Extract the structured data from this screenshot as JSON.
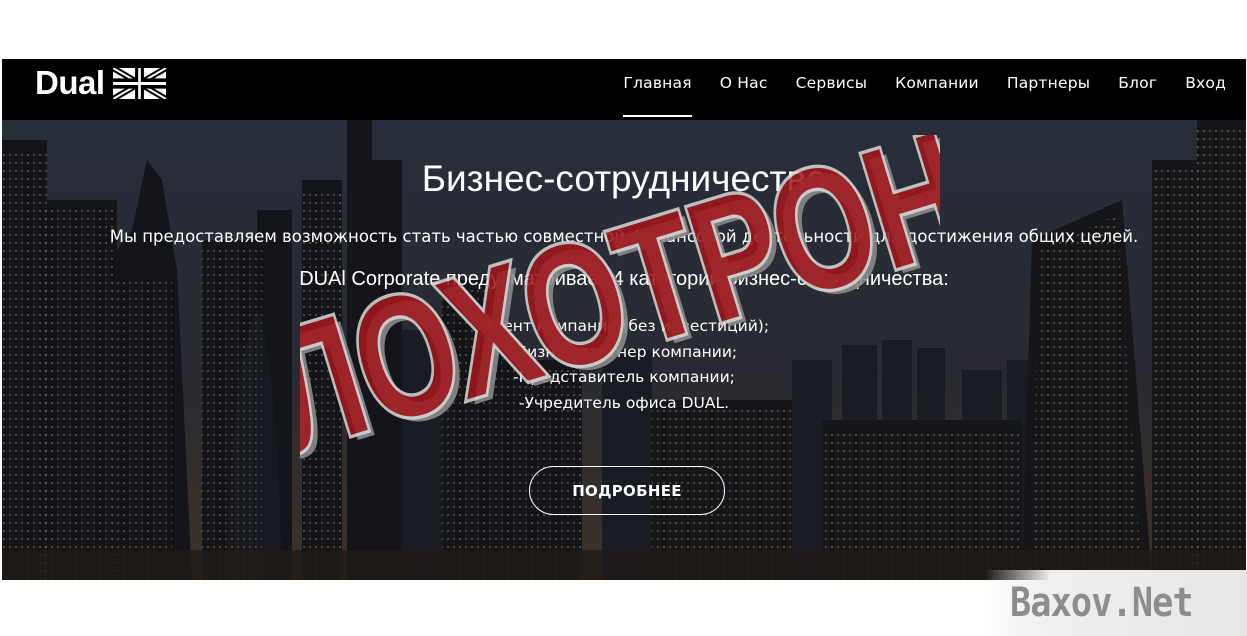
{
  "header": {
    "logo_text": "Dual",
    "logo_flag": "uk-flag-icon",
    "nav": [
      {
        "label": "Главная",
        "active": true
      },
      {
        "label": "О Нас",
        "active": false
      },
      {
        "label": "Сервисы",
        "active": false
      },
      {
        "label": "Компании",
        "active": false
      },
      {
        "label": "Партнеры",
        "active": false
      },
      {
        "label": "Блог",
        "active": false
      },
      {
        "label": "Вход",
        "active": false
      }
    ]
  },
  "hero": {
    "title": "Бизнес-сотрудничество",
    "description": "Мы предоставляем возможность стать частью совместной финансовой деятельности для достижения общих целей.",
    "subtitle": "DUAl Corporate предусматривает 4 категории бизнес-сотрудничества:",
    "categories": [
      "-Агент компании (без инвестиций);",
      "-Бизнес партнер компании;",
      "-Представитель компании;",
      "-Учредитель офиса DUAL."
    ],
    "button_label": "ПОДРОБНЕЕ",
    "background": "city-skyline-image"
  },
  "stamp_text": "ЛОХОТРОН",
  "watermark_text": "Baxov.Net",
  "colors": {
    "navbar_bg": "#000000",
    "text": "#ffffff",
    "stamp_red": "#a3171b",
    "watermark_gray": "#8d8d8d"
  }
}
